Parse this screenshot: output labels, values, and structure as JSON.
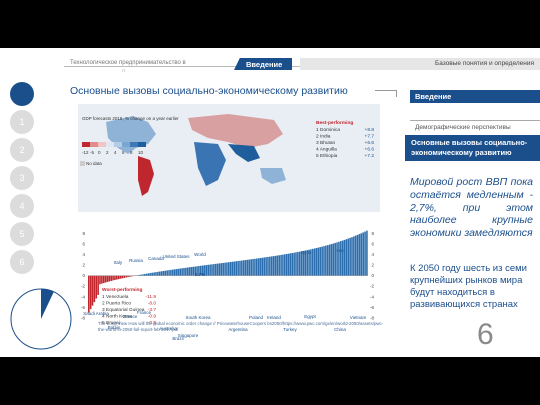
{
  "header": {
    "left_title": "Технологическое предпринимательство в",
    "left_sub": "IT",
    "section_tab": "Введение",
    "right_title": "Базовые понятия и определения"
  },
  "steps": [
    "1",
    "2",
    "3",
    "4",
    "5",
    "6"
  ],
  "progress": {
    "fraction": 0.07
  },
  "main_title": "Основные вызовы социально-экономическому развитию",
  "right_panel": {
    "intro": "Введение",
    "demo": "Демографические перспективы",
    "current": "Основные вызовы социально-экономическому развитию",
    "text1": "Мировой рост ВВП пока остаётся медленным - 2,7%, при этом наиболее крупные экономики замедляются",
    "text2": "К 2050 году шесть из семи крупнейших рынков мира будут находиться в развивающихся странах",
    "page_number": "6"
  },
  "colors": {
    "accent": "#1b4f8c",
    "positive": "#1f5e9c",
    "negative": "#c0262d"
  },
  "chart_data": {
    "type": "bar",
    "title": "GDP forecasts 2018, % change on a year earlier",
    "legend_scale": [
      "-12",
      "-5",
      "0",
      "2",
      "4",
      "6",
      "8",
      "10"
    ],
    "no_data_label": "No data",
    "best_title": "Best-performing",
    "best": [
      {
        "rank": "1",
        "name": "Dominica",
        "value": "+8.8"
      },
      {
        "rank": "2",
        "name": "India",
        "value": "+7.7"
      },
      {
        "rank": "3",
        "name": "Bhutan",
        "value": "+6.6"
      },
      {
        "rank": "4",
        "name": "Anguilla",
        "value": "+6.6"
      },
      {
        "rank": "5",
        "name": "Ethiopia",
        "value": "+7.2"
      }
    ],
    "worst_title": "Worst-performing",
    "worst": [
      {
        "rank": "1",
        "name": "Venezuela",
        "value": "-11.9"
      },
      {
        "rank": "2",
        "name": "Puerto Rico",
        "value": "-8.0"
      },
      {
        "rank": "3",
        "name": "Equatorial Guinea",
        "value": "-3.7"
      },
      {
        "rank": "4",
        "name": "North Korea",
        "value": "-0.9"
      },
      {
        "rank": "5",
        "name": "Brunei",
        "value": "-0.5"
      }
    ],
    "yticks": [
      "8",
      "6",
      "4",
      "2",
      "0",
      "-2",
      "-4",
      "-6",
      "-8"
    ],
    "ylim": [
      -8,
      9
    ],
    "world": {
      "label": "World",
      "value": "2.7%"
    },
    "labels_above": [
      "Italy",
      "Russia",
      "Canada",
      "United States",
      "World",
      "Syria",
      "Iran"
    ],
    "labels_below": [
      "Saudi Arabia",
      "Britain",
      "Greece",
      "France",
      "Brazil",
      "Australia",
      "Singapore",
      "South Korea",
      "Argentina",
      "Poland",
      "Ireland",
      "Turkey",
      "Egypt",
      "China",
      "Vietnam"
    ],
    "caption": "The Long View How will the global economic order change // PricewaterhouseCoopers bs2050/https://www.pwc.com/gx/en/world-2050/assets/pwc-the-world-in-2050-full-report-feb-2017.pdf"
  }
}
